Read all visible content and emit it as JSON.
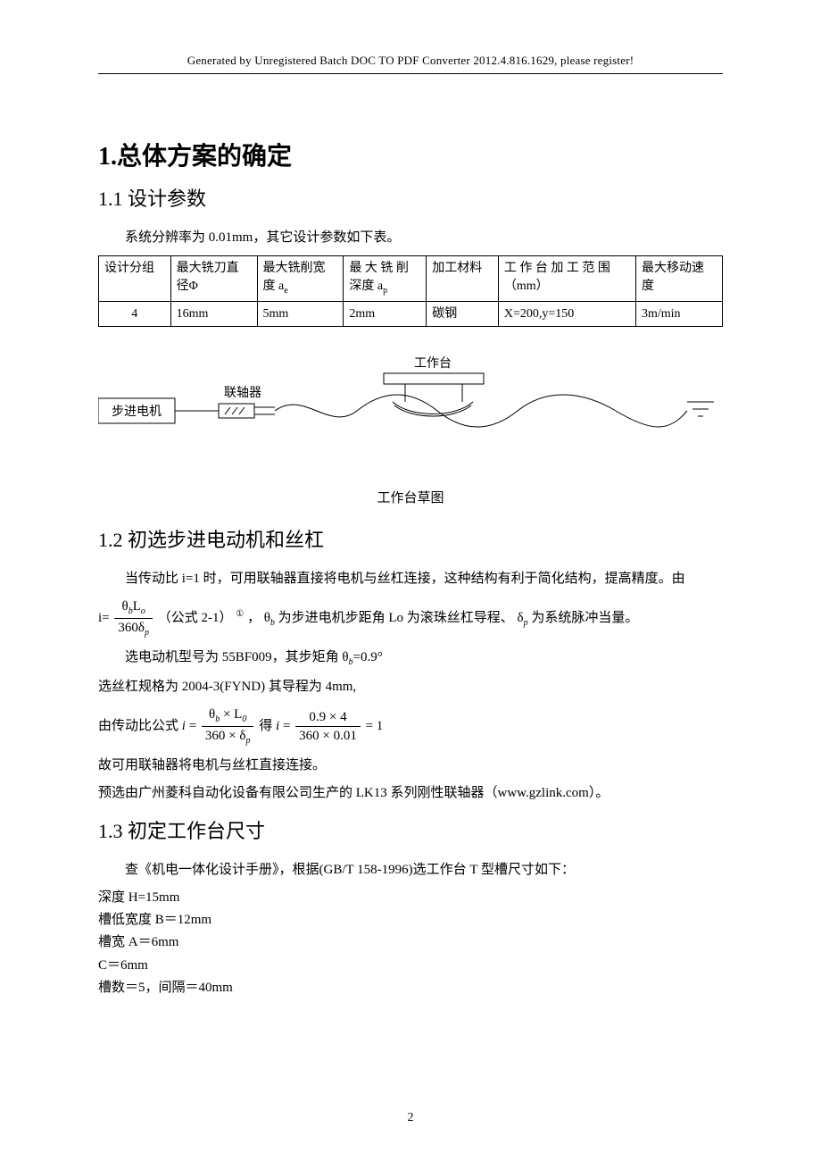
{
  "watermark": "Generated by Unregistered Batch DOC TO PDF Converter 2012.4.816.1629, please register!",
  "section1": {
    "title_num": "1.",
    "title_text": "总体方案的确定",
    "sub1": {
      "heading": "1.1 设计参数",
      "intro": "系统分辨率为 0.01mm，其它设计参数如下表。",
      "table": {
        "headers": [
          "设计分组",
          "最大铣刀直径Φ",
          "最大铣削宽度 aₑ",
          "最大铣削深度 aₚ",
          "加工材料",
          "工作台加工范围（mm）",
          "最大移动速度"
        ],
        "h0": "设计分组",
        "h1a": "最大铣刀直",
        "h1b": "径Φ",
        "h2a": "最大铣削宽",
        "h2b": "度 a",
        "h2sub": "e",
        "h3a": "最 大 铣 削",
        "h3b": "深度 a",
        "h3sub": "p",
        "h4": "加工材料",
        "h5a": "工 作 台 加 工 范 围",
        "h5b": "（mm）",
        "h6a": "最大移动速",
        "h6b": "度",
        "row": {
          "c0": "4",
          "c1": "16mm",
          "c2": "5mm",
          "c3": "2mm",
          "c4": "碳钢",
          "c5": "X=200,y=150",
          "c6": "3m/min"
        }
      },
      "diagram": {
        "motor": "步进电机",
        "coupling": "联轴器",
        "table": "工作台",
        "caption": "工作台草图"
      }
    },
    "sub2": {
      "heading": "1.2 初选步进电动机和丝杠",
      "p1": "当传动比 i=1 时，可用联轴器直接将电机与丝杠连接，这种结构有利于简化结构，提高精度。由",
      "formula1_left": "i=",
      "formula1_num_theta": "θ",
      "formula1_num_sub_b": "b",
      "formula1_num_L": "L",
      "formula1_num_sub_o": "o",
      "formula1_den_360": "360",
      "formula1_den_delta": "δ",
      "formula1_den_sub_p": "p",
      "formula1_note": "（公式 2-1）",
      "formula1_circ": "①",
      "formula1_tail1": "， θ",
      "formula1_tail_sub_b": "b",
      "formula1_tail2": "为步进电机步距角 Lo 为滚珠丝杠导程、",
      "formula1_tail_delta": "δ",
      "formula1_tail_sub_p": "p",
      "formula1_tail3": "为系统脉冲当量。",
      "p2a": "选电动机型号为 55BF009，其步矩角",
      "p2_theta": "θ",
      "p2_sub": "b",
      "p2b": "=0.9°",
      "p3": "选丝杠规格为 2004-3(FYND)    其导程为 4mm,",
      "p4_pre": "由传动比公式",
      "p4_i": "i",
      "p4_eq": " = ",
      "p4_num1_theta": "θ",
      "p4_num1_sub": "b",
      "p4_num1_times": " × ",
      "p4_num1_L": "L",
      "p4_num1_Lsub": "0",
      "p4_den1_360": "360 × ",
      "p4_den1_delta": "δ",
      "p4_den1_sub": "p",
      "p4_de": "得   ",
      "p4_num2": "0.9 × 4",
      "p4_den2": "360 × 0.01",
      "p4_eq1": " = 1",
      "p5": "故可用联轴器将电机与丝杠直接连接。",
      "p6": "预选由广州菱科自动化设备有限公司生产的 LK13 系列刚性联轴器（www.gzlink.com）。"
    },
    "sub3": {
      "heading": "1.3 初定工作台尺寸",
      "p1": "查《机电一体化设计手册》，根据(GB/T 158-1996)选工作台 T 型槽尺寸如下：",
      "l1": "深度 H=15mm",
      "l2": "槽低宽度 B＝12mm",
      "l3": "槽宽 A＝6mm",
      "l4": "C＝6mm",
      "l5": "槽数＝5，间隔＝40mm"
    }
  },
  "page_number": "2"
}
